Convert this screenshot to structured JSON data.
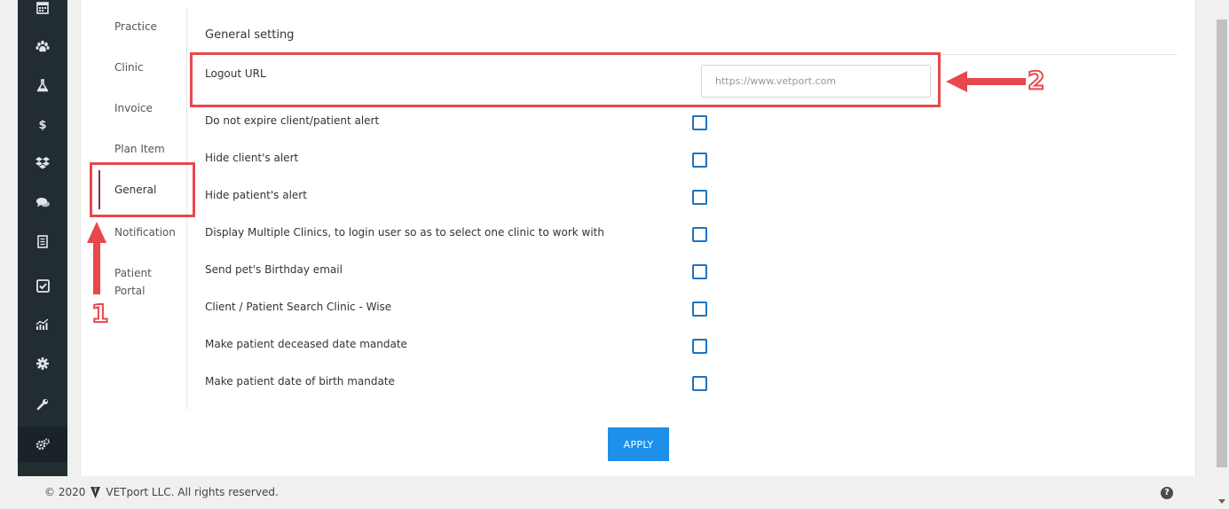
{
  "settings_tabs": [
    {
      "label": "Practice",
      "active": false
    },
    {
      "label": "Clinic",
      "active": false
    },
    {
      "label": "Invoice",
      "active": false
    },
    {
      "label": "Plan Item",
      "active": false
    },
    {
      "label": "General",
      "active": true
    },
    {
      "label": "Notification",
      "active": false
    },
    {
      "label": "Patient Portal",
      "active": false
    }
  ],
  "general": {
    "title": "General setting",
    "logout_url": {
      "label": "Logout URL",
      "placeholder": "https://www.vetport.com",
      "value": ""
    },
    "options": [
      {
        "label": "Do not expire client/patient alert",
        "checked": false
      },
      {
        "label": "Hide client's alert",
        "checked": false
      },
      {
        "label": "Hide patient's alert",
        "checked": false
      },
      {
        "label": "Display Multiple Clinics, to login user so as to select one clinic to work with",
        "checked": false
      },
      {
        "label": "Send pet's Birthday email",
        "checked": false
      },
      {
        "label": "Client / Patient Search Clinic - Wise",
        "checked": false
      },
      {
        "label": "Make patient deceased date mandate",
        "checked": false
      },
      {
        "label": "Make patient date of birth mandate",
        "checked": false
      }
    ],
    "apply_label": "APPLY"
  },
  "sidebar_icons": [
    "calendar-icon",
    "paw-icon",
    "flask-icon",
    "dollar-icon",
    "dropbox-icon",
    "comments-icon",
    "receipt-icon",
    "check-square-icon",
    "chart-icon",
    "gear-icon",
    "wrench-icon",
    "cogs-icon"
  ],
  "annotations": {
    "marker_1": "1",
    "marker_2": "2"
  },
  "footer": {
    "copyright": "© 2020",
    "company": "VETport LLC. All rights reserved.",
    "help_glyph": "?"
  },
  "colors": {
    "accent": "#1e90ea",
    "checkbox": "#1e73be",
    "annotation": "#e8484c",
    "sidebar": "#222d32",
    "active_tab_marker": "#8a2b56"
  }
}
